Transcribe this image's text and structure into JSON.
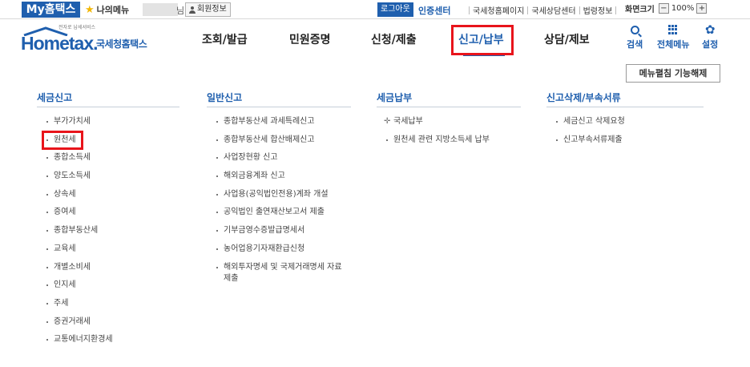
{
  "topbar": {
    "my_hometax": "My홈택스",
    "my_menu": "나의메뉴",
    "name_suffix": "님",
    "member_info": "회원정보",
    "logout": "로그아웃",
    "cert_center": "인증센터",
    "links": [
      "국세청홈페이지",
      "국세상담센터",
      "법령정보"
    ],
    "zoom_label": "화면크기",
    "zoom_minus": "−",
    "zoom_value": "100%",
    "zoom_plus": "+"
  },
  "header": {
    "logo_tag": "전자로 납세서비스",
    "logo_main": "Hometax.",
    "logo_sub": "국세청홈택스",
    "nav": [
      "조회/발급",
      "민원증명",
      "신청/제출",
      "신고/납부",
      "상담/제보"
    ],
    "active_nav_index": 3,
    "tools": {
      "search": "검색",
      "all_menu": "전체메뉴",
      "settings": "설정"
    },
    "accent_color": "#1f5fae",
    "highlight_color": "#e8141b"
  },
  "panel": {
    "unpin_button": "메뉴펼침 기능해제",
    "columns": [
      {
        "title": "세금신고",
        "items": [
          "부가가치세",
          "원천세",
          "종합소득세",
          "양도소득세",
          "상속세",
          "증여세",
          "종합부동산세",
          "교육세",
          "개별소비세",
          "인지세",
          "주세",
          "증권거래세",
          "교통에너지환경세"
        ]
      },
      {
        "title": "일반신고",
        "items": [
          "종합부동산세 과세특례신고",
          "종합부동산세 합산배제신고",
          "사업장현황 신고",
          "해외금융계좌 신고",
          "사업용(공익법인전용)계좌 개설",
          "공익법인 출연재산보고서 제출",
          "기부금영수증발급명세서",
          "농어업용기자재환급신청",
          "해외투자명세 및 국제거래명세 자료 제출"
        ]
      },
      {
        "title": "세금납부",
        "items": [
          "국세납부",
          "원천세 관련 지방소득세 납부"
        ]
      },
      {
        "title": "신고삭제/부속서류",
        "items": [
          "세금신고 삭제요청",
          "신고부속서류제출"
        ]
      }
    ]
  }
}
